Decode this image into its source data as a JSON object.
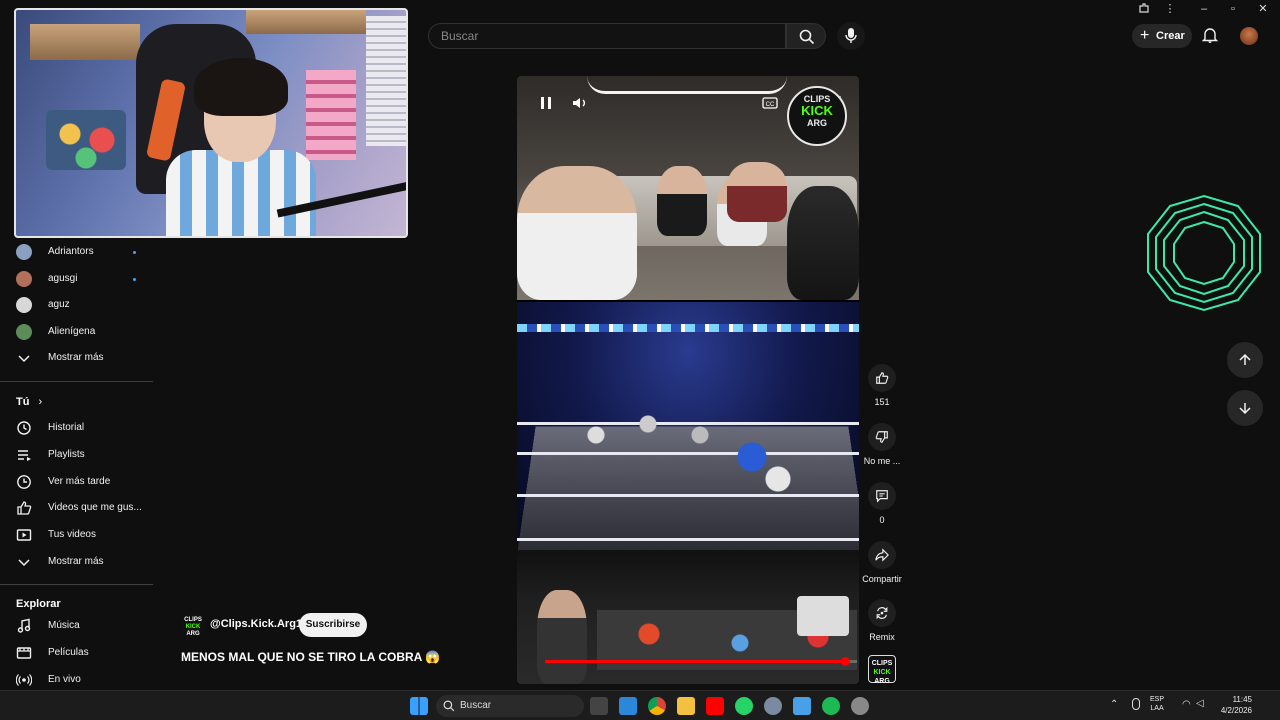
{
  "search": {
    "placeholder": "Buscar"
  },
  "header": {
    "create_label": "Crear"
  },
  "sidebar": {
    "channels": [
      {
        "label": "Adriantors",
        "avatar_color": "#8aa0c0",
        "has_dot": true
      },
      {
        "label": "agusgi",
        "avatar_color": "#b2705a",
        "has_dot": true
      },
      {
        "label": "aguz",
        "avatar_color": "#d8d8d8",
        "has_dot": false
      },
      {
        "label": "Alienígena",
        "avatar_color": "#5b8c5a",
        "has_dot": false
      }
    ],
    "show_more_1": "Mostrar más",
    "you_heading": "Tú",
    "you_items": [
      {
        "label": "Historial",
        "icon": "history-icon"
      },
      {
        "label": "Playlists",
        "icon": "playlists-icon"
      },
      {
        "label": "Ver más tarde",
        "icon": "watch-later-icon"
      },
      {
        "label": "Videos que me gus...",
        "icon": "liked-videos-icon"
      },
      {
        "label": "Tus videos",
        "icon": "your-videos-icon"
      }
    ],
    "show_more_2": "Mostrar más",
    "explore_heading": "Explorar",
    "explore_items": [
      {
        "label": "Música",
        "icon": "music-icon"
      },
      {
        "label": "Películas",
        "icon": "movies-icon"
      },
      {
        "label": "En vivo",
        "icon": "live-icon"
      }
    ]
  },
  "short": {
    "channel_handle": "@Clips.Kick.Arg1",
    "subscribe_label": "Suscribirse",
    "title": "MENOS MAL QUE NO SE TIRO LA COBRA 😱",
    "logo_line1": "CLIPS",
    "logo_line2": "KICK",
    "logo_line3": "ARG",
    "progress": 0.96
  },
  "actions": {
    "likes": "151",
    "dislike_label": "No me ...",
    "comments": "0",
    "share_label": "Compartir",
    "remix_label": "Remix"
  },
  "taskbar": {
    "search_label": "Buscar",
    "lang_line1": "ESP",
    "lang_line2": "LAA",
    "time": "11:45",
    "date": "4/2/2026"
  },
  "colors": {
    "accent_red": "#ff0000",
    "kick_green": "#53fc18",
    "loader_green": "#3de8a8"
  }
}
